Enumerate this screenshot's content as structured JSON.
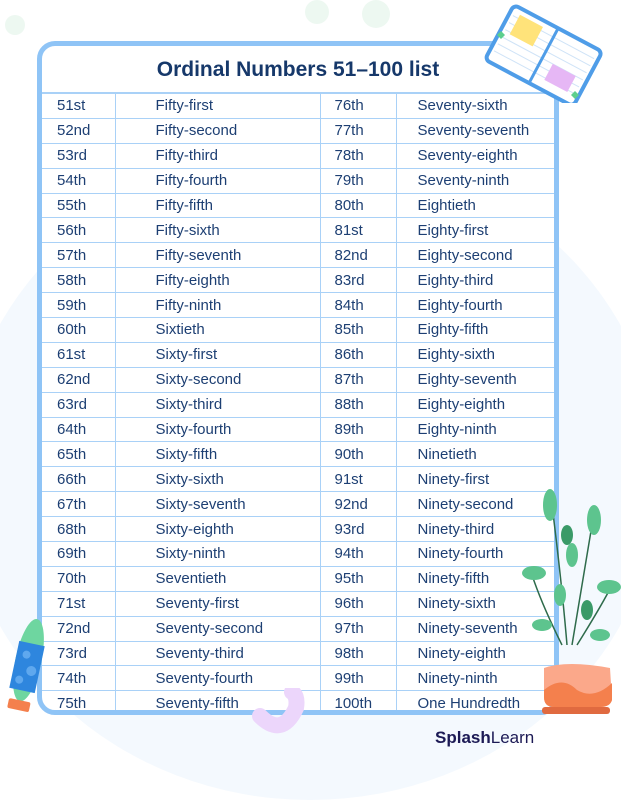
{
  "title": "Ordinal Numbers 51–100 list",
  "rows": [
    {
      "left_ordinal": "51st",
      "left_word": "Fifty-first",
      "right_ordinal": "76th",
      "right_word": "Seventy-sixth"
    },
    {
      "left_ordinal": "52nd",
      "left_word": "Fifty-second",
      "right_ordinal": "77th",
      "right_word": "Seventy-seventh"
    },
    {
      "left_ordinal": "53rd",
      "left_word": "Fifty-third",
      "right_ordinal": "78th",
      "right_word": "Seventy-eighth"
    },
    {
      "left_ordinal": "54th",
      "left_word": "Fifty-fourth",
      "right_ordinal": "79th",
      "right_word": "Seventy-ninth"
    },
    {
      "left_ordinal": "55th",
      "left_word": "Fifty-fifth",
      "right_ordinal": "80th",
      "right_word": "Eightieth"
    },
    {
      "left_ordinal": "56th",
      "left_word": "Fifty-sixth",
      "right_ordinal": "81st",
      "right_word": "Eighty-first"
    },
    {
      "left_ordinal": "57th",
      "left_word": "Fifty-seventh",
      "right_ordinal": "82nd",
      "right_word": "Eighty-second"
    },
    {
      "left_ordinal": "58th",
      "left_word": "Fifty-eighth",
      "right_ordinal": "83rd",
      "right_word": "Eighty-third"
    },
    {
      "left_ordinal": "59th",
      "left_word": "Fifty-ninth",
      "right_ordinal": "84th",
      "right_word": "Eighty-fourth"
    },
    {
      "left_ordinal": "60th",
      "left_word": "Sixtieth",
      "right_ordinal": "85th",
      "right_word": "Eighty-fifth"
    },
    {
      "left_ordinal": "61st",
      "left_word": "Sixty-first",
      "right_ordinal": "86th",
      "right_word": "Eighty-sixth"
    },
    {
      "left_ordinal": "62nd",
      "left_word": "Sixty-second",
      "right_ordinal": "87th",
      "right_word": "Eighty-seventh"
    },
    {
      "left_ordinal": "63rd",
      "left_word": "Sixty-third",
      "right_ordinal": "88th",
      "right_word": "Eighty-eighth"
    },
    {
      "left_ordinal": "64th",
      "left_word": "Sixty-fourth",
      "right_ordinal": "89th",
      "right_word": "Eighty-ninth"
    },
    {
      "left_ordinal": "65th",
      "left_word": "Sixty-fifth",
      "right_ordinal": "90th",
      "right_word": "Ninetieth"
    },
    {
      "left_ordinal": "66th",
      "left_word": "Sixty-sixth",
      "right_ordinal": "91st",
      "right_word": "Ninety-first"
    },
    {
      "left_ordinal": "67th",
      "left_word": "Sixty-seventh",
      "right_ordinal": "92nd",
      "right_word": "Ninety-second"
    },
    {
      "left_ordinal": "68th",
      "left_word": "Sixty-eighth",
      "right_ordinal": "93rd",
      "right_word": "Ninety-third"
    },
    {
      "left_ordinal": "69th",
      "left_word": "Sixty-ninth",
      "right_ordinal": "94th",
      "right_word": "Ninety-fourth"
    },
    {
      "left_ordinal": "70th",
      "left_word": "Seventieth",
      "right_ordinal": "95th",
      "right_word": "Ninety-fifth"
    },
    {
      "left_ordinal": "71st",
      "left_word": "Seventy-first",
      "right_ordinal": "96th",
      "right_word": "Ninety-sixth"
    },
    {
      "left_ordinal": "72nd",
      "left_word": "Seventy-second",
      "right_ordinal": "97th",
      "right_word": "Ninety-seventh"
    },
    {
      "left_ordinal": "73rd",
      "left_word": "Seventy-third",
      "right_ordinal": "98th",
      "right_word": "Ninety-eighth"
    },
    {
      "left_ordinal": "74th",
      "left_word": "Seventy-fourth",
      "right_ordinal": "99th",
      "right_word": "Ninety-ninth"
    },
    {
      "left_ordinal": "75th",
      "left_word": "Seventy-fifth",
      "right_ordinal": "100th",
      "right_word": "One Hundredth"
    }
  ],
  "brand": {
    "bold": "Splash",
    "light": "Learn"
  },
  "colors": {
    "text": "#1d3f73",
    "title": "#16386a",
    "border": "#8fc4f6",
    "grid": "#a9d1f7",
    "brand": "#1c1a55"
  }
}
